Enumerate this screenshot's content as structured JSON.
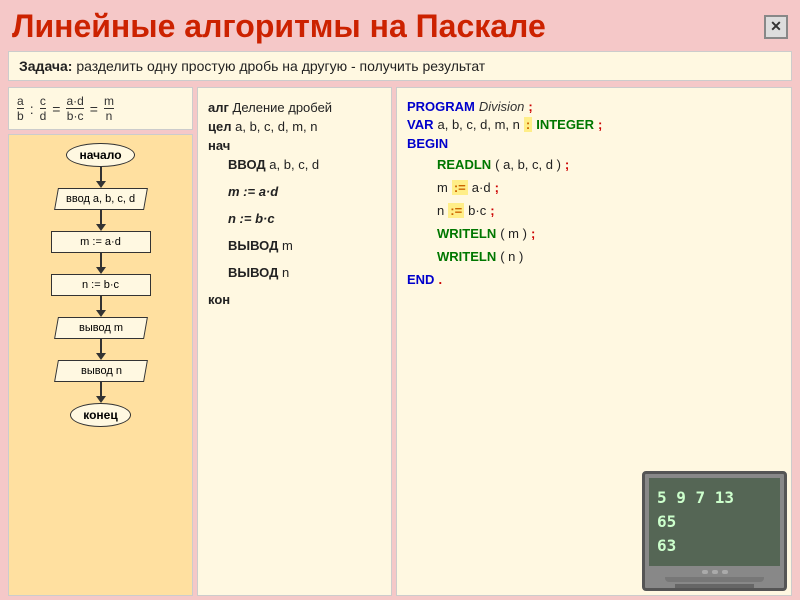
{
  "header": {
    "title": "Линейные алгоритмы на Паскале",
    "close_label": "✕"
  },
  "task": {
    "label": "Задача:",
    "text": " разделить одну простую дробь на другую - получить результат"
  },
  "fraction": {
    "line1": "a   c   a·d   m",
    "line2": ": — = ——— =",
    "line3": "b   d   b·c   n"
  },
  "flowchart": {
    "nodes": [
      {
        "type": "oval",
        "text": "начало"
      },
      {
        "type": "parallelogram",
        "text": "ввод a, b, c, d"
      },
      {
        "type": "rect",
        "text": "m := a·d"
      },
      {
        "type": "rect",
        "text": "n := b·c"
      },
      {
        "type": "parallelogram",
        "text": "вывод m"
      },
      {
        "type": "parallelogram",
        "text": "вывод n"
      },
      {
        "type": "oval",
        "text": "конец"
      }
    ]
  },
  "algorithm": {
    "title_kw": "алг",
    "title_name": "Деление дробей",
    "var_kw": "цел",
    "var_list": "a, b, c, d, m, n",
    "begin_kw": "нач",
    "input_kw": "ВВОД",
    "input_vars": "a, b, c, d",
    "assign1": "m := a·d",
    "assign2": "n := b·c",
    "output1_kw": "ВЫВОД",
    "output1_var": "m",
    "output2_kw": "ВЫВОД",
    "output2_var": "n",
    "end_kw": "кон"
  },
  "pascal": {
    "program_kw": "PROGRAM",
    "program_name": "Division",
    "semicolon": ";",
    "var_kw": "VAR",
    "var_list": "a, b, c, d, m, n",
    "colon": ":",
    "integer_kw": "INTEGER",
    "begin_kw": "BEGIN",
    "readln_kw": "READLN",
    "readln_args": "( a, b, c, d )",
    "assign_m": "m",
    "assign_op": ":=",
    "assign_m_val": "a·d",
    "assign_n": "n",
    "assign_n_val": "b·c",
    "writeln_kw": "WRITELN",
    "writeln_m_args": "( m )",
    "writeln_n_args": "( n )",
    "end_kw": "END",
    "dot": "."
  },
  "monitor": {
    "lines": [
      "5  9  7  13",
      "65",
      "63"
    ]
  }
}
